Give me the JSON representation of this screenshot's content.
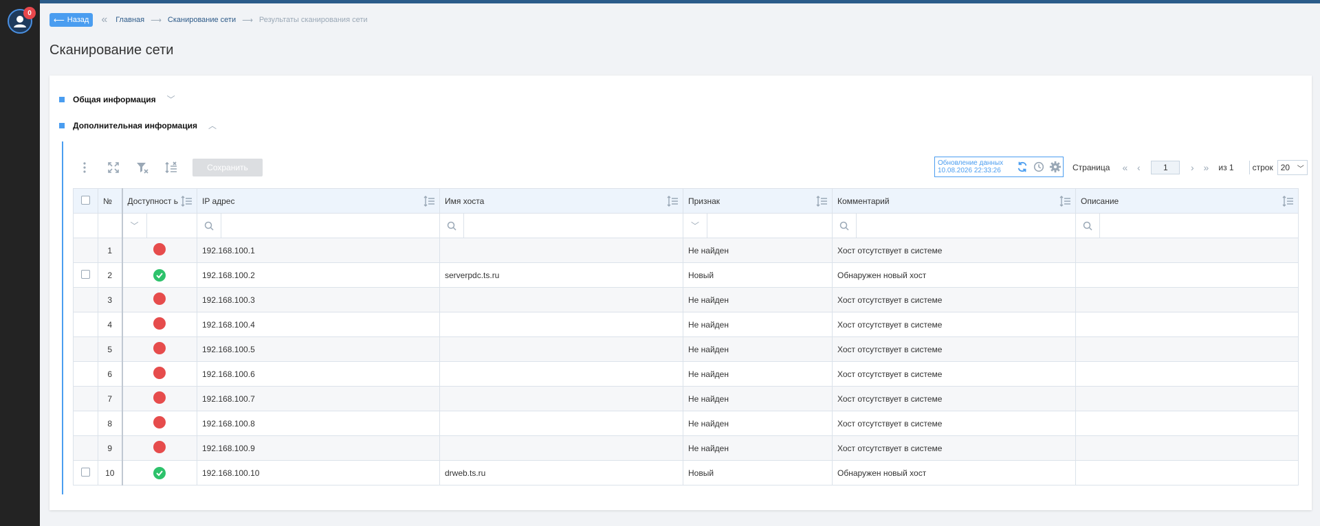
{
  "sidebar": {
    "badge_count": "0"
  },
  "breadcrumb": {
    "back_label": "Назад",
    "items": [
      "Главная",
      "Сканирование сети"
    ],
    "current": "Результаты сканирования сети"
  },
  "page": {
    "title": "Сканирование сети"
  },
  "sections": {
    "general": "Общая информация",
    "additional": "Дополнительная информация"
  },
  "toolbar": {
    "save_label": "Сохранить"
  },
  "update": {
    "label": "Обновление данных",
    "timestamp": "10.08.2026 22:33:26"
  },
  "pager": {
    "page_label": "Страница",
    "page_value": "1",
    "of_label": "из 1",
    "rows_label": "строк",
    "rows_value": "20"
  },
  "table": {
    "headers": {
      "num": "№",
      "availability": "Доступност ь",
      "ip": "IP адрес",
      "hostname": "Имя хоста",
      "sign": "Признак",
      "comment": "Комментарий",
      "description": "Описание"
    },
    "rows": [
      {
        "num": "1",
        "status": "down",
        "ip": "192.168.100.1",
        "hostname": "",
        "sign": "Не найден",
        "comment": "Хост отсутствует в системе",
        "description": "",
        "checkbox": false
      },
      {
        "num": "2",
        "status": "up",
        "ip": "192.168.100.2",
        "hostname": "serverpdc.ts.ru",
        "sign": "Новый",
        "comment": "Обнаружен новый хост",
        "description": "",
        "checkbox": true
      },
      {
        "num": "3",
        "status": "down",
        "ip": "192.168.100.3",
        "hostname": "",
        "sign": "Не найден",
        "comment": "Хост отсутствует в системе",
        "description": "",
        "checkbox": false
      },
      {
        "num": "4",
        "status": "down",
        "ip": "192.168.100.4",
        "hostname": "",
        "sign": "Не найден",
        "comment": "Хост отсутствует в системе",
        "description": "",
        "checkbox": false
      },
      {
        "num": "5",
        "status": "down",
        "ip": "192.168.100.5",
        "hostname": "",
        "sign": "Не найден",
        "comment": "Хост отсутствует в системе",
        "description": "",
        "checkbox": false
      },
      {
        "num": "6",
        "status": "down",
        "ip": "192.168.100.6",
        "hostname": "",
        "sign": "Не найден",
        "comment": "Хост отсутствует в системе",
        "description": "",
        "checkbox": false
      },
      {
        "num": "7",
        "status": "down",
        "ip": "192.168.100.7",
        "hostname": "",
        "sign": "Не найден",
        "comment": "Хост отсутствует в системе",
        "description": "",
        "checkbox": false
      },
      {
        "num": "8",
        "status": "down",
        "ip": "192.168.100.8",
        "hostname": "",
        "sign": "Не найден",
        "comment": "Хост отсутствует в системе",
        "description": "",
        "checkbox": false
      },
      {
        "num": "9",
        "status": "down",
        "ip": "192.168.100.9",
        "hostname": "",
        "sign": "Не найден",
        "comment": "Хост отсутствует в системе",
        "description": "",
        "checkbox": false
      },
      {
        "num": "10",
        "status": "up",
        "ip": "192.168.100.10",
        "hostname": "drweb.ts.ru",
        "sign": "Новый",
        "comment": "Обнаружен новый хост",
        "description": "",
        "checkbox": true
      }
    ]
  },
  "colors": {
    "accent": "#4a9df0",
    "down": "#e64c4c",
    "up": "#2dc26b",
    "sidebar": "#232323"
  }
}
